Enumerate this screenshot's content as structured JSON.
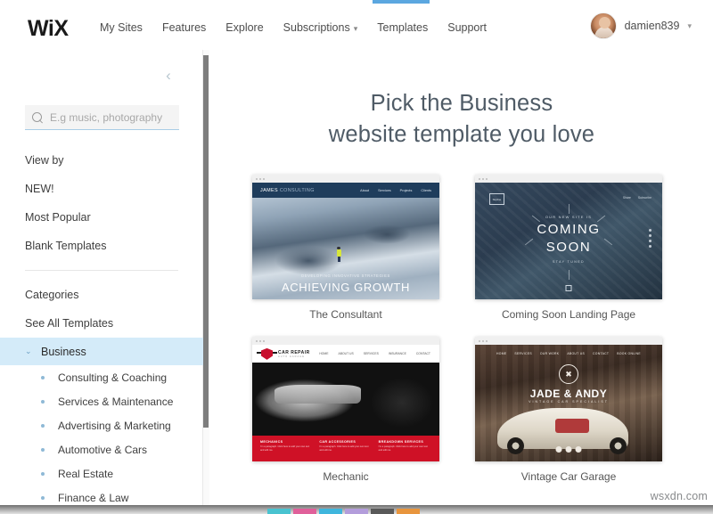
{
  "header": {
    "logo": "WiX",
    "nav": [
      {
        "label": "My Sites",
        "has_caret": false
      },
      {
        "label": "Features",
        "has_caret": false
      },
      {
        "label": "Explore",
        "has_caret": false
      },
      {
        "label": "Subscriptions",
        "has_caret": true
      },
      {
        "label": "Templates",
        "has_caret": false
      },
      {
        "label": "Support",
        "has_caret": false
      }
    ],
    "active_tab": "Templates",
    "user": {
      "name": "damien839",
      "caret": "⌄"
    },
    "accent_color": "#5ba7e0"
  },
  "sidebar": {
    "collapse_icon": "‹",
    "search": {
      "placeholder": "E.g music, photography",
      "value": "",
      "icon": "search-icon"
    },
    "view_by_label": "View by",
    "view_by_items": [
      {
        "label": "NEW!"
      },
      {
        "label": "Most Popular"
      },
      {
        "label": "Blank Templates"
      }
    ],
    "categories_label": "Categories",
    "see_all_label": "See All Templates",
    "active_category": {
      "label": "Business",
      "chevron": "⌄",
      "highlight_color": "#d4ebf9"
    },
    "subcategories": [
      {
        "label": "Consulting & Coaching"
      },
      {
        "label": "Services & Maintenance"
      },
      {
        "label": "Advertising & Marketing"
      },
      {
        "label": "Automotive & Cars"
      },
      {
        "label": "Real Estate"
      },
      {
        "label": "Finance & Law"
      }
    ]
  },
  "main": {
    "title_line1": "Pick the Business",
    "title_line2": "website template you love",
    "templates": [
      {
        "name": "The Consultant",
        "preview": {
          "brand_strong": "JAMES",
          "brand_light": " CONSULTING",
          "nav": [
            "About",
            "Services",
            "Projects",
            "Clients"
          ],
          "subtitle": "DEVELOPING INNOVATIVE STRATEGIES",
          "headline": "ACHIEVING GROWTH"
        }
      },
      {
        "name": "Coming Soon Landing Page",
        "preview": {
          "logo_text": "Skyline",
          "nav": [
            "Share",
            "Subscribe"
          ],
          "pre": "OUR NEW SITE IS",
          "headline_line1": "COMING",
          "headline_line2": "SOON",
          "post": "STAY TUNED"
        }
      },
      {
        "name": "Mechanic",
        "preview": {
          "brand": "CAR REPAIR",
          "tagline": "AUTO GARAGE",
          "nav": [
            "HOME",
            "ABOUT US",
            "SERVICES",
            "INSURANCE",
            "CONTACT"
          ],
          "columns": [
            {
              "title": "MECHANICS",
              "body": "I'm a paragraph. Click here to add your own text and edit me."
            },
            {
              "title": "CAR ACCESSORIES",
              "body": "I'm a paragraph. Click here to add your own text and edit me."
            },
            {
              "title": "BREAKDOWN SERVICES",
              "body": "I'm a paragraph. Click here to add your own text and edit me."
            }
          ]
        }
      },
      {
        "name": "Vintage Car Garage",
        "preview": {
          "nav": [
            "HOME",
            "SERVICES",
            "OUR WORK",
            "ABOUT US",
            "CONTACT",
            "BOOK ONLINE"
          ],
          "emblem": "✖",
          "title": "JADE & ANDY",
          "subtitle": "VINTAGE CAR SPECIALIST"
        }
      }
    ]
  },
  "watermark": {
    "text": "wsxdn.com"
  },
  "taskbar": {
    "icons": [
      {
        "name": "app-icon-teal",
        "color": "#49c3d0"
      },
      {
        "name": "app-icon-pink",
        "color": "#e0609a"
      },
      {
        "name": "app-icon-cyan",
        "color": "#3fb6dd"
      },
      {
        "name": "app-icon-purple",
        "color": "#b39ddb"
      },
      {
        "name": "app-icon-darkgray",
        "color": "#595959"
      },
      {
        "name": "app-icon-orange",
        "color": "#e8953d"
      }
    ]
  }
}
